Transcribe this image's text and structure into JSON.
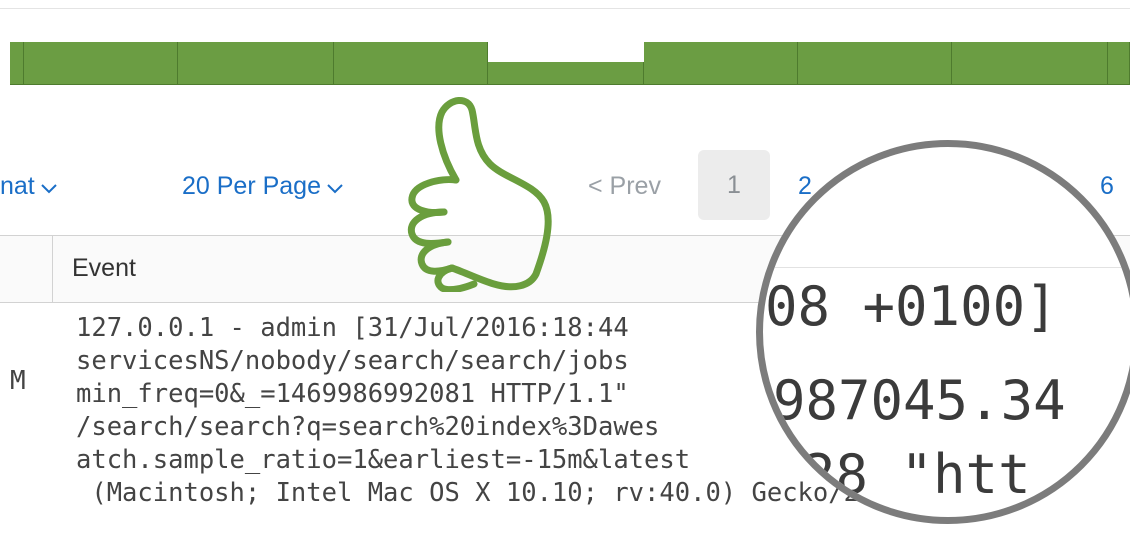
{
  "timeline": {
    "accent": "#6b9d43"
  },
  "pager": {
    "format_label": "nat",
    "per_page_label": "20 Per Page",
    "prev_label": "< Prev",
    "pages": [
      "1",
      "2",
      "6"
    ],
    "current_page": "1"
  },
  "table": {
    "header_event": "Event"
  },
  "event": {
    "time_fragment": "M",
    "lines": [
      "127.0.0.1 - admin [31/Jul/2016:18:44",
      "servicesNS/nobody/search/search/jobs",
      "min_freq=0&_=1469986992081 HTTP/1.1\"",
      "/search/search?q=search%20index%3Dawes",
      "atch.sample_ratio=1&earliest=-15m&latest",
      " (Macintosh; Intel Mac OS X 10.10; rv:40.0) Gecko/20100"
    ]
  },
  "magnifier": {
    "line1": "08 +0100]",
    "line2": "987045.34",
    "line3": "28 \"htt"
  },
  "icons": {
    "thumb": "thumbs-up-icon",
    "magnifier": "magnifying-glass-lens"
  }
}
